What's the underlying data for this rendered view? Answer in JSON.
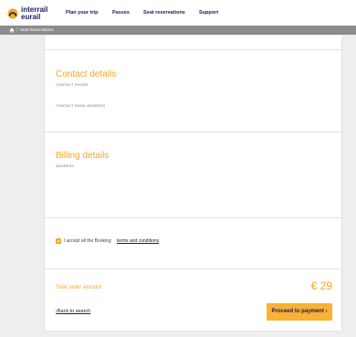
{
  "header": {
    "logo_line1": "interrail",
    "logo_line2": "eurail",
    "nav": [
      "Plan your trip",
      "Passes",
      "Seat reservations",
      "Support"
    ]
  },
  "breadcrumb": {
    "current": "Seat Reservations"
  },
  "contact": {
    "title": "Contact details",
    "phone_label": "CONTACT PHONE",
    "email_label": "CONTACT EMAIL ADDRESS"
  },
  "billing": {
    "title": "Billing details",
    "address_label": "ADDRESS"
  },
  "terms": {
    "checked": true,
    "text": "I accept all the Booking",
    "link": "terms and conditions"
  },
  "order": {
    "total_label": "Total order amount",
    "total_amount": "€ 29"
  },
  "actions": {
    "back_label": "Back to search",
    "proceed_label": "Proceed to payment"
  },
  "colors": {
    "accent": "#f5a623",
    "button": "#f9b233",
    "brand_navy": "#1b1b5e",
    "breadcrumb_bar": "#8c8c8c"
  }
}
